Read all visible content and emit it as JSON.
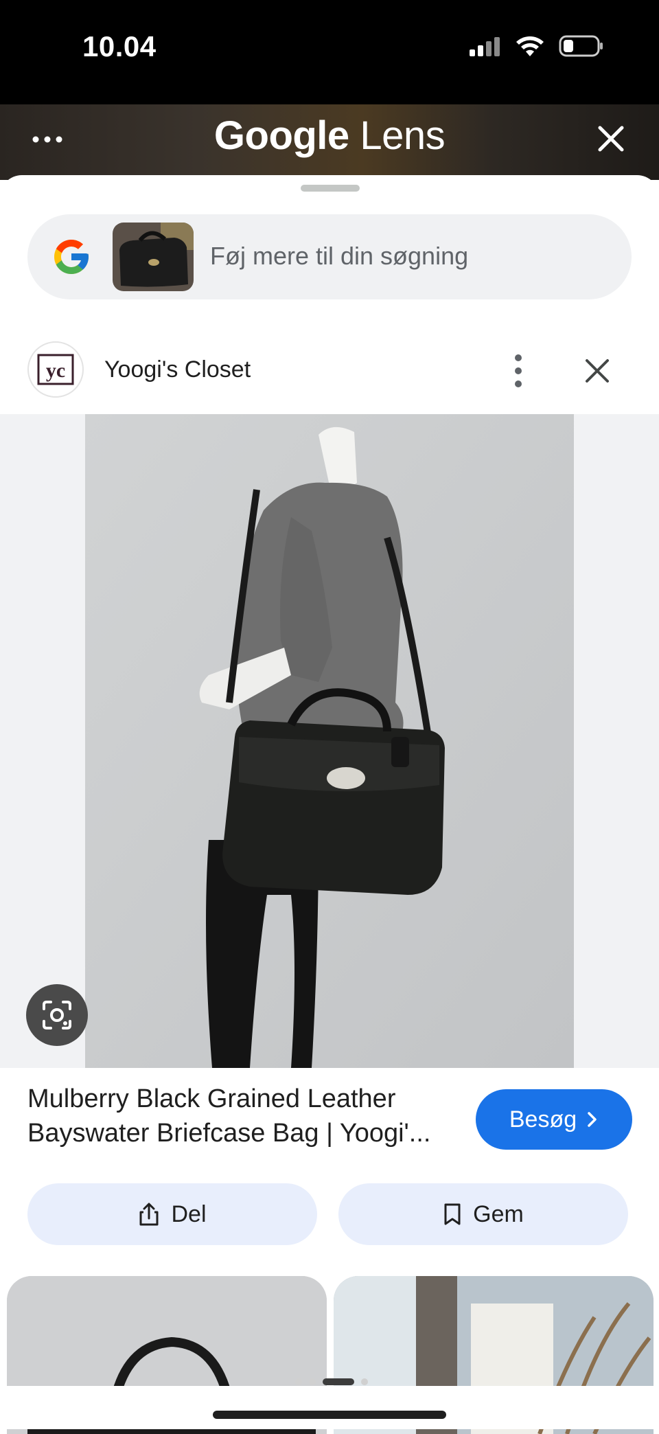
{
  "status_bar": {
    "time": "10.04"
  },
  "lens_bar": {
    "title_brand": "Google",
    "title_product": "Lens",
    "menu_icon": "more-horizontal-icon",
    "close_icon": "close-icon"
  },
  "search": {
    "placeholder": "Føj mere til din søgning",
    "logo_icon": "google-g-icon"
  },
  "source": {
    "name": "Yoogi's Closet",
    "avatar_text": "yc"
  },
  "result": {
    "title": "Mulberry Black Grained Leather Bayswater Briefcase Bag | Yoogi'...",
    "visit_label": "Besøg",
    "share_label": "Del",
    "save_label": "Gem"
  },
  "colors": {
    "accent_blue": "#1a73e8",
    "pill_bg": "#e8eefc",
    "search_bg": "#f0f1f3"
  }
}
